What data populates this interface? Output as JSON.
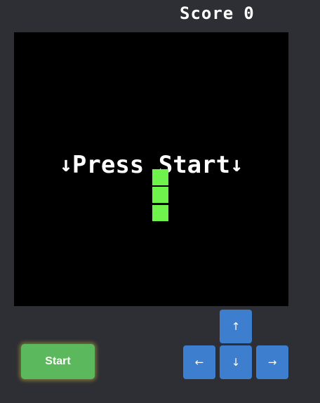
{
  "score": {
    "label": "Score",
    "value": "0"
  },
  "board": {
    "message": "Press Start",
    "message_icon": "down-arrow-icon",
    "snake": [
      {
        "col": 8,
        "row": 8
      },
      {
        "col": 8,
        "row": 9
      },
      {
        "col": 8,
        "row": 10
      }
    ],
    "snake_color": "#6ff24c",
    "background_color": "#000000"
  },
  "controls": {
    "start_label": "Start",
    "start_color": "#5cb85c",
    "pad_color": "#3d7fce",
    "up_icon": "arrow-up-icon",
    "down_icon": "arrow-down-icon",
    "left_icon": "arrow-left-icon",
    "right_icon": "arrow-right-icon"
  }
}
